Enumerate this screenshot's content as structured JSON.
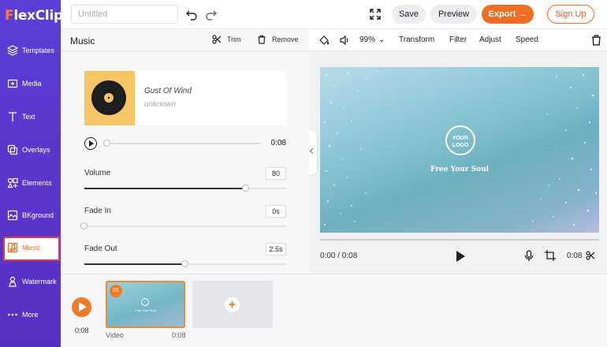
{
  "app": {
    "brand": "FlexClip"
  },
  "sidebar": {
    "items": [
      {
        "label": "Templates",
        "icon": "layers-icon"
      },
      {
        "label": "Media",
        "icon": "media-icon"
      },
      {
        "label": "Text",
        "icon": "text-icon"
      },
      {
        "label": "Overlays",
        "icon": "overlays-icon"
      },
      {
        "label": "Elements",
        "icon": "elements-icon"
      },
      {
        "label": "BKground",
        "icon": "background-icon"
      },
      {
        "label": "Music",
        "icon": "music-icon",
        "active": true
      },
      {
        "label": "Watermark",
        "icon": "watermark-icon"
      },
      {
        "label": "More",
        "icon": "more-icon"
      }
    ]
  },
  "topbar": {
    "title_placeholder": "Untitled",
    "save": "Save",
    "preview": "Preview",
    "export": "Export",
    "signup": "Sign Up"
  },
  "music_panel": {
    "title": "Music",
    "trim": "Trim",
    "remove": "Remove",
    "song": "Gust Of Wind",
    "artist": "unknown",
    "duration": "0:08",
    "volume_label": "Volume",
    "volume_value": "80",
    "fade_in_label": "Fade In",
    "fade_in_value": "0s",
    "fade_out_label": "Fade Out",
    "fade_out_value": "2.5s"
  },
  "preview_toolbar": {
    "zoom": "99%",
    "transform": "Transform",
    "filter": "Filter",
    "adjust": "Adjust",
    "speed": "Speed"
  },
  "canvas": {
    "logo_line1": "YOUR",
    "logo_line2": "LOGO",
    "caption": "Free Your Soul"
  },
  "playback": {
    "time": "0:00 / 0:08",
    "clip_duration": "0:08"
  },
  "timeline": {
    "time": "0:08",
    "clip_index": "01",
    "clip_name": "Video",
    "clip_duration": "0:08"
  },
  "colors": {
    "brand_purple": "#5a36cc",
    "accent_orange": "#f06e22"
  }
}
